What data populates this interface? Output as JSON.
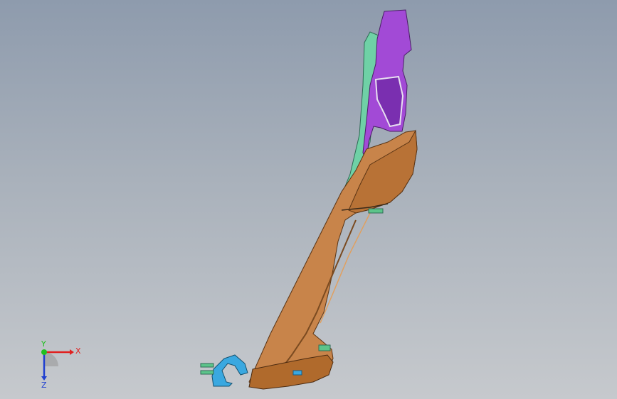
{
  "viewport": {
    "background_top": "#8e9bad",
    "background_bottom": "#c6c9cd"
  },
  "model": {
    "colors": {
      "purple": "#a24ad6",
      "orange": "#c8844a",
      "green": "#6fd1a6",
      "blue": "#3aa8e0",
      "edge": "#3a2a1a"
    }
  },
  "triad": {
    "x_label": "X",
    "y_label": "Y",
    "z_label": "Z",
    "x_color": "#e02020",
    "y_color": "#20c020",
    "z_color": "#2040d0"
  }
}
